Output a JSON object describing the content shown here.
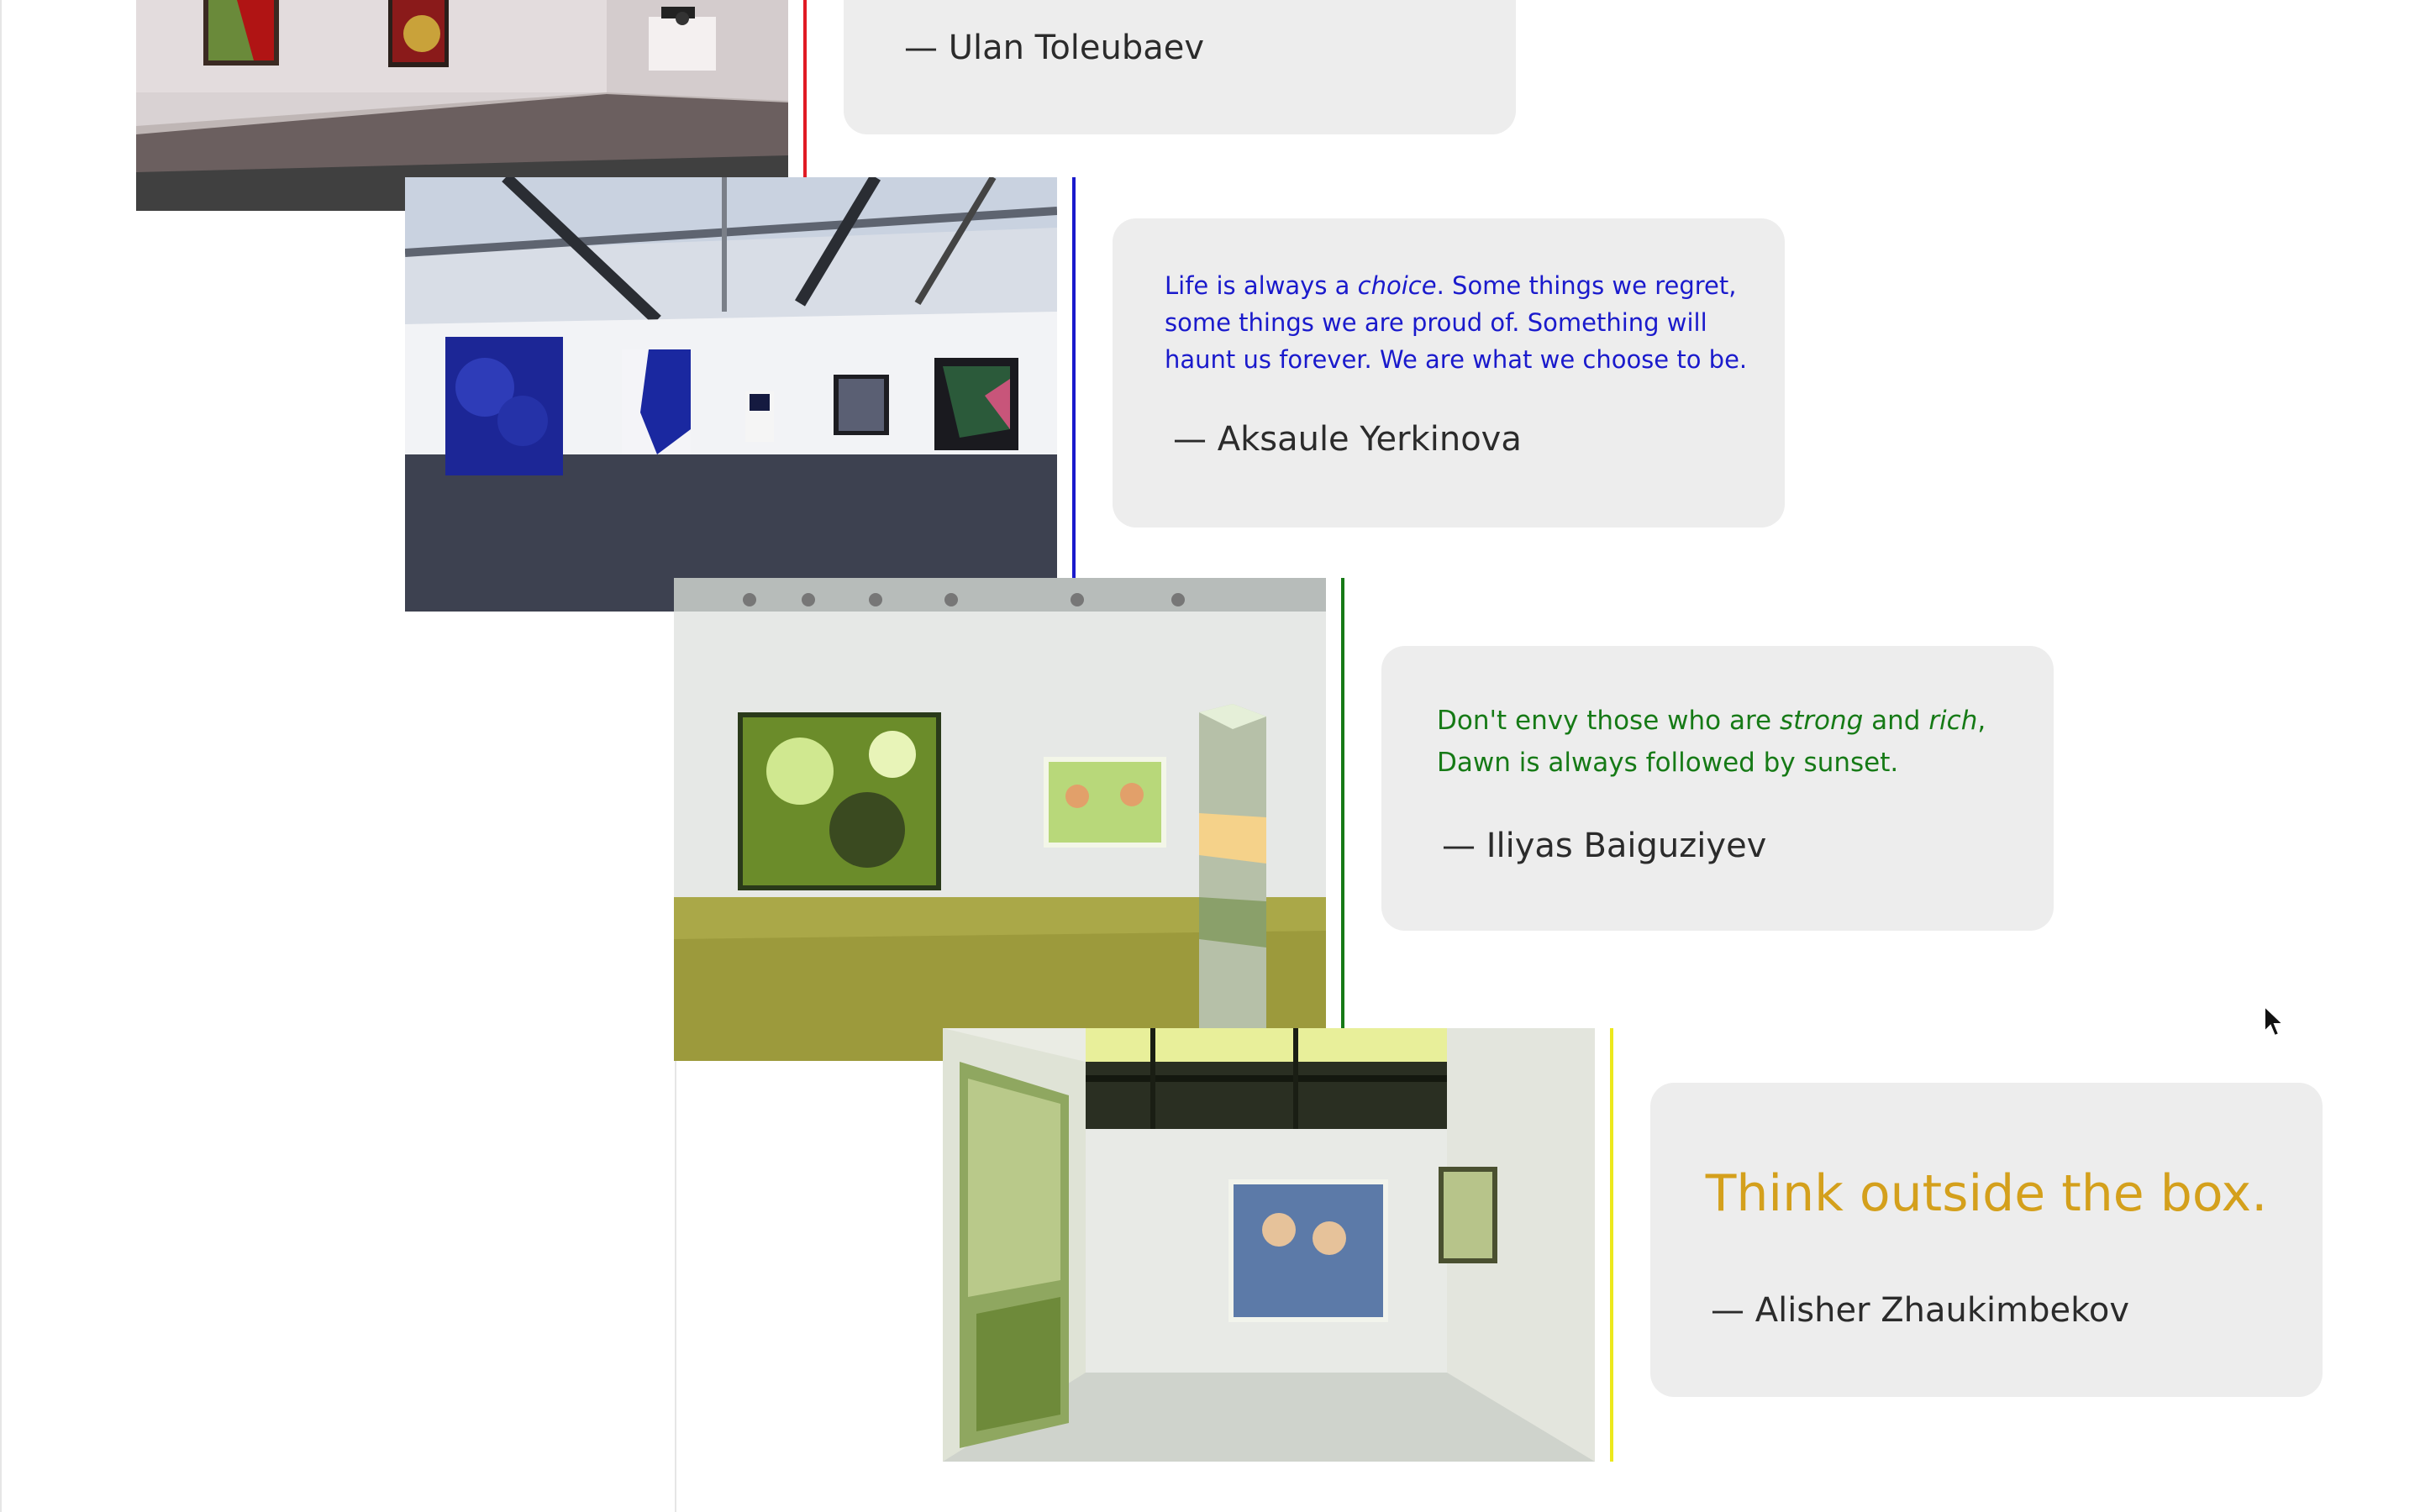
{
  "colors": {
    "red": "#e01b24",
    "blue": "#1a1acc",
    "green": "#167a16",
    "yellow": "#ece81c",
    "gold": "#d4a01c",
    "card_bg": "#ededed",
    "author_text": "#2b2b2b"
  },
  "items": [
    {
      "photo_icon": "gallery-room-photo",
      "author": "— Ulan Toleubaev"
    },
    {
      "photo_icon": "gallery-room-photo",
      "quote_parts": [
        "Life is always a ",
        "choice",
        ". Some things we regret, some things we are proud of. Something will haunt us forever. We are what we choose to be."
      ],
      "author": "— Aksaule Yerkinova"
    },
    {
      "photo_icon": "gallery-room-photo",
      "quote_parts": [
        "Don't envy those who are ",
        "strong",
        " and ",
        "rich",
        ", Dawn is always followed by sunset."
      ],
      "author": "— Iliyas Baiguziyev"
    },
    {
      "photo_icon": "gallery-room-photo",
      "quote": "Think outside the box.",
      "author": "— Alisher Zhaukimbekov"
    }
  ],
  "cursor_icon": "mouse-pointer-icon"
}
